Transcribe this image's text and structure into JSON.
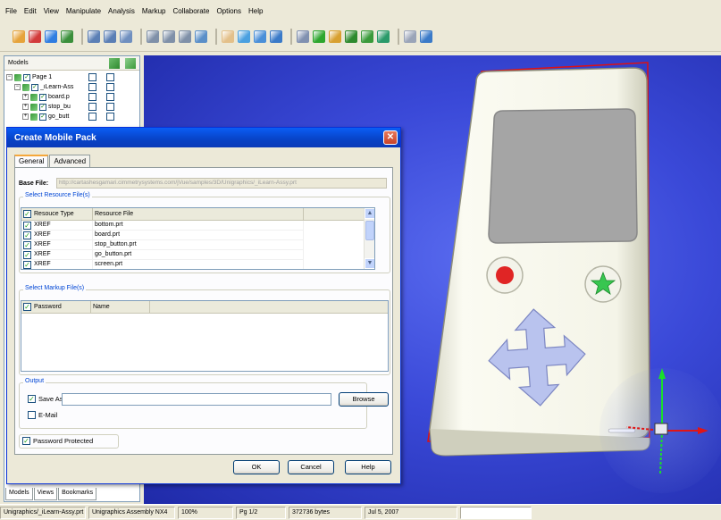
{
  "menu": [
    "File",
    "Edit",
    "View",
    "Manipulate",
    "Analysis",
    "Markup",
    "Collaborate",
    "Options",
    "Help"
  ],
  "toolbar_icons": [
    {
      "name": "open-icon",
      "color": "#e6a33a"
    },
    {
      "name": "pen-icon",
      "color": "#d23a3a"
    },
    {
      "name": "pen-alt-icon",
      "color": "#2f7de1"
    },
    {
      "name": "tree-icon",
      "color": "#3a8f3a"
    },
    {
      "name": "sep"
    },
    {
      "name": "print-icon",
      "color": "#5b7fb5"
    },
    {
      "name": "print-preview-icon",
      "color": "#5b7fb5"
    },
    {
      "name": "copy-icon",
      "color": "#6f8fbf"
    },
    {
      "name": "sep"
    },
    {
      "name": "layout-1-icon",
      "color": "#7f90a8"
    },
    {
      "name": "layout-2-icon",
      "color": "#7f90a8"
    },
    {
      "name": "layout-3-icon",
      "color": "#7f90a8"
    },
    {
      "name": "find-icon",
      "color": "#5a8fc8"
    },
    {
      "name": "sep"
    },
    {
      "name": "pan-hand-icon",
      "color": "#e3c08a"
    },
    {
      "name": "rotate-icon",
      "color": "#4aa0e0"
    },
    {
      "name": "zoom-icon",
      "color": "#4a8fd8"
    },
    {
      "name": "fit-icon",
      "color": "#3a7ac8"
    },
    {
      "name": "sep"
    },
    {
      "name": "monitor-icon",
      "color": "#8090b0"
    },
    {
      "name": "cube-green-icon",
      "color": "#2ea62e"
    },
    {
      "name": "brush-icon",
      "color": "#d8a030"
    },
    {
      "name": "cube-icon",
      "color": "#2e8a2e"
    },
    {
      "name": "explode-icon",
      "color": "#3a9a3a"
    },
    {
      "name": "axes-icon",
      "color": "#2a9a6a"
    },
    {
      "name": "sep"
    },
    {
      "name": "section-icon",
      "color": "#9aa4b8"
    },
    {
      "name": "measure-icon",
      "color": "#3a7ac8"
    }
  ],
  "models_panel": {
    "header": "Models",
    "tree": [
      {
        "indent": 0,
        "label": "Page 1",
        "pm": "−"
      },
      {
        "indent": 1,
        "label": "_iLearn-Ass",
        "pm": "−"
      },
      {
        "indent": 2,
        "label": "board.p",
        "pm": "+"
      },
      {
        "indent": 2,
        "label": "stop_bu",
        "pm": "+"
      },
      {
        "indent": 2,
        "label": "go_butt",
        "pm": "+"
      }
    ],
    "tabs": [
      "Models",
      "Views",
      "Bookmarks"
    ]
  },
  "dialog": {
    "title": "Create Mobile Pack",
    "tabs": [
      "General",
      "Advanced"
    ],
    "base_file_label": "Base File:",
    "base_file_value": "http://cartashesgamari.cimmetrysystems.com/jVue/samples/3D/Unigraphics/_iLearn-Assy.prt",
    "resource_group_label": "Select Resource File(s)",
    "resource_columns": [
      "Resouce Type",
      "Resource File"
    ],
    "resources": [
      {
        "type": "XREF",
        "file": "bottom.prt"
      },
      {
        "type": "XREF",
        "file": "board.prt"
      },
      {
        "type": "XREF",
        "file": "stop_button.prt"
      },
      {
        "type": "XREF",
        "file": "go_button.prt"
      },
      {
        "type": "XREF",
        "file": "screen.prt"
      }
    ],
    "markup_group_label": "Select Markup File(s)",
    "markup_columns": [
      "Password",
      "Name"
    ],
    "output_group_label": "Output",
    "save_as_label": "Save As",
    "save_as_value": "",
    "browse_label": "Browse",
    "email_label": "E-Mail",
    "password_protected_label": "Password Protected",
    "ok_label": "OK",
    "cancel_label": "Cancel",
    "help_label": "Help"
  },
  "status": {
    "file": "Unigraphics/_iLearn-Assy.prt",
    "type": "Unigraphics Assembly NX4",
    "zoom": "100%",
    "page": "Pg 1/2",
    "size": "372736 bytes",
    "date": "Jul 5, 2007"
  }
}
